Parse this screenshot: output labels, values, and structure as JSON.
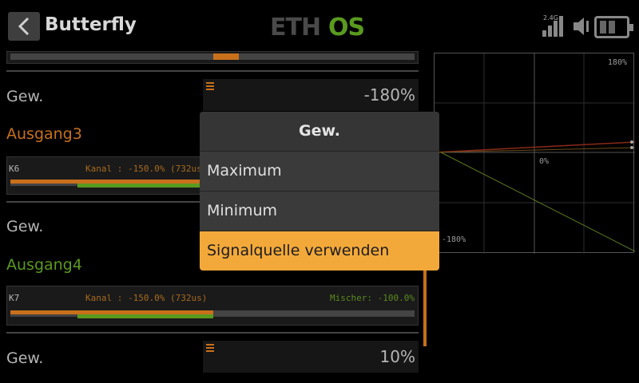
{
  "header": {
    "title": "Butterfly",
    "brand": "ETHOS",
    "signal_label": "2.4G"
  },
  "rows": {
    "row1_label": "Gew.",
    "row1_value": "-180%",
    "section3_title": "Ausgang3",
    "ch3_name": "K6",
    "ch3_kanal": "Kanal : -150.0% (732us)",
    "row2_label": "Gew.",
    "section4_title": "Ausgang4",
    "ch4_name": "K7",
    "ch4_kanal": "Kanal : -150.0% (732us)",
    "ch4_mix": "Mischer: -100.0%",
    "row3_label": "Gew.",
    "row3_value": "10%"
  },
  "graph": {
    "top_label": "180%",
    "mid_label": "0%",
    "bottom_label": "-180%"
  },
  "modal": {
    "title": "Gew.",
    "options": [
      "Maximum",
      "Minimum",
      "Signalquelle verwenden"
    ],
    "selected_index": 2
  },
  "colors": {
    "accent": "#f3a93a",
    "orange": "#c8701c",
    "green": "#5a9a1e"
  },
  "icons": {
    "back": "chevron-left-icon",
    "signal": "signal-bars-icon",
    "volume": "speaker-icon",
    "battery": "battery-icon"
  }
}
